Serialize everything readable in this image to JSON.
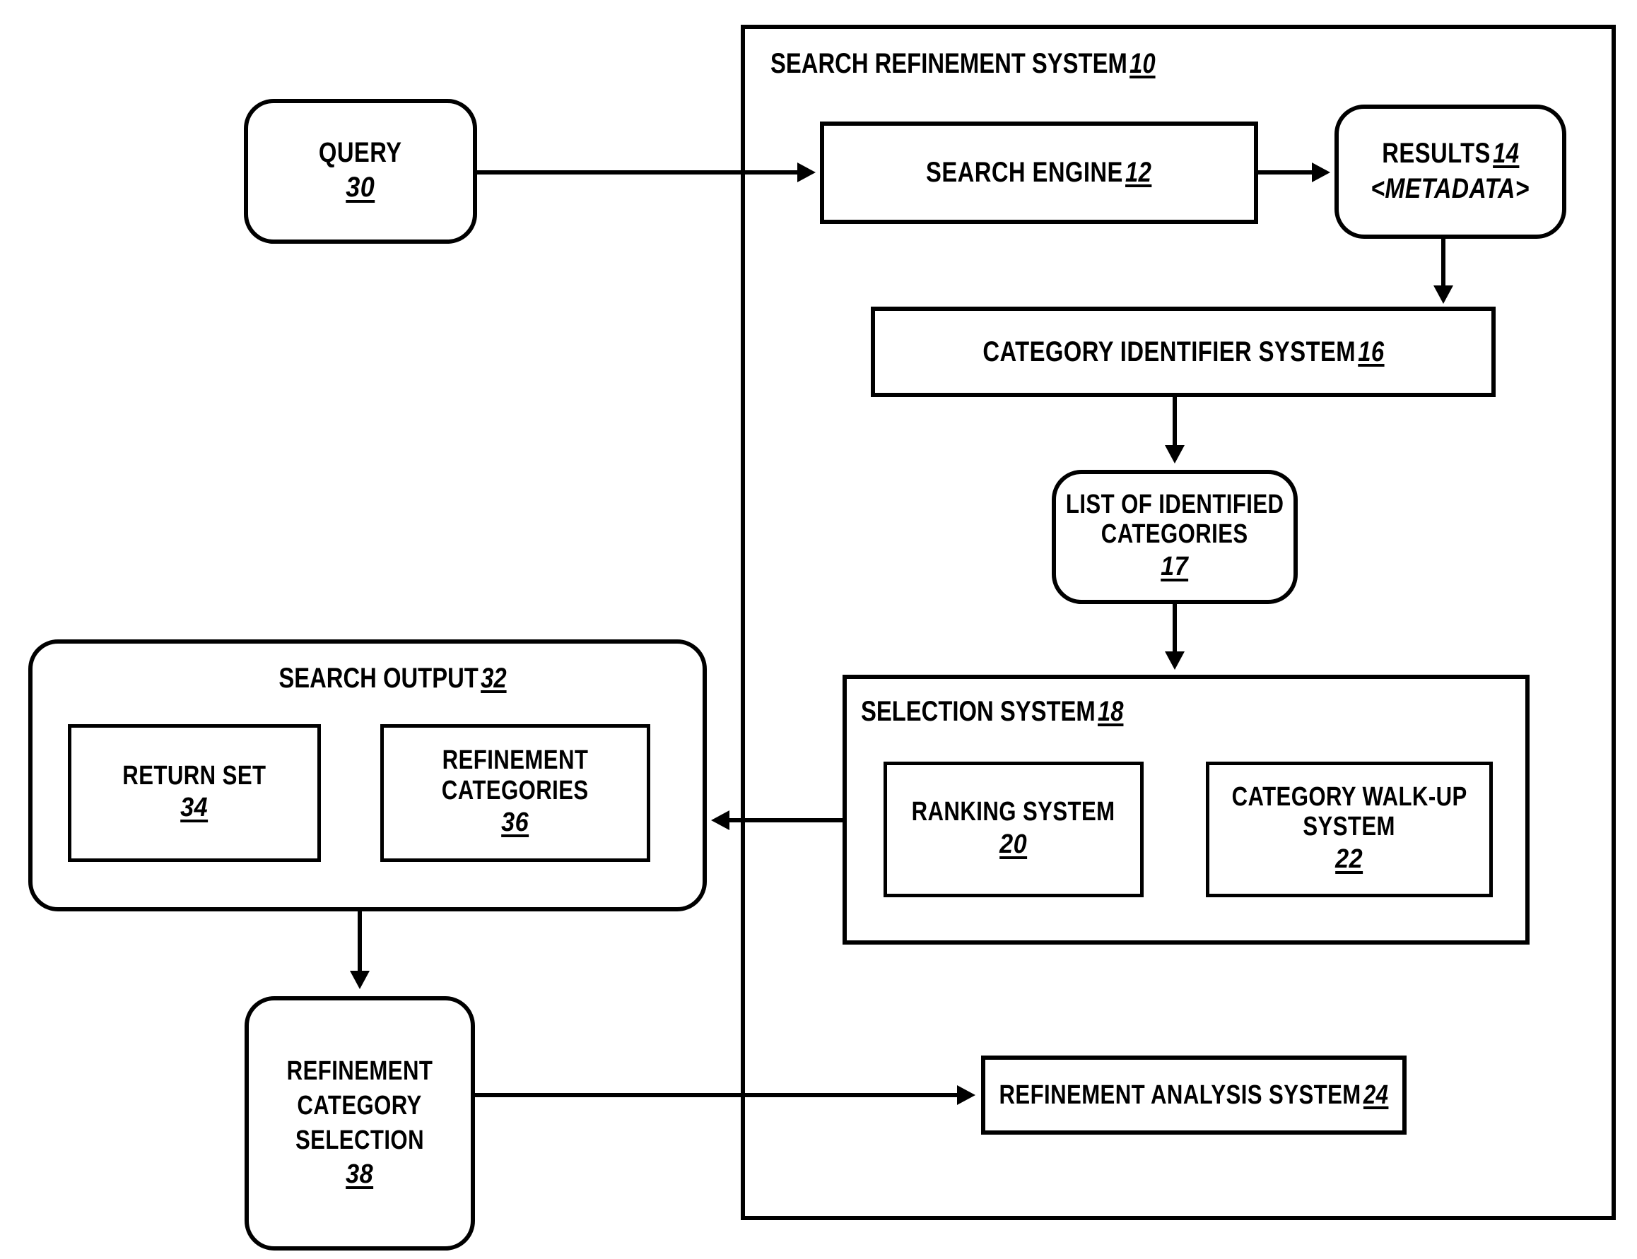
{
  "figure": {
    "type": "patent-block-diagram",
    "background": "#ffffff",
    "ink_color": "#000000"
  },
  "outer_system": {
    "label": "SEARCH REFINEMENT SYSTEM",
    "ref": "10"
  },
  "nodes": {
    "query": {
      "label": "QUERY",
      "ref": "30"
    },
    "search_engine": {
      "label": "SEARCH ENGINE",
      "ref": "12"
    },
    "results": {
      "label": "RESULTS",
      "ref": "14",
      "metadata": "<METADATA>"
    },
    "category_identifier": {
      "label": "CATEGORY IDENTIFIER SYSTEM",
      "ref": "16"
    },
    "list_categories": {
      "line1": "LIST OF IDENTIFIED",
      "line2": "CATEGORIES",
      "ref": "17"
    },
    "selection_system": {
      "label": "SELECTION SYSTEM",
      "ref": "18"
    },
    "ranking_system": {
      "label": "RANKING SYSTEM",
      "ref": "20"
    },
    "category_walkup": {
      "line1": "CATEGORY WALK-UP",
      "line2": "SYSTEM",
      "ref": "22"
    },
    "search_output": {
      "label": "SEARCH OUTPUT",
      "ref": "32"
    },
    "return_set": {
      "label": "RETURN SET",
      "ref": "34"
    },
    "refinement_categories": {
      "line1": "REFINEMENT",
      "line2": "CATEGORIES",
      "ref": "36"
    },
    "refinement_selection": {
      "line1": "REFINEMENT",
      "line2": "CATEGORY",
      "line3": "SELECTION",
      "ref": "38"
    },
    "refinement_analysis": {
      "label": "REFINEMENT ANALYSIS SYSTEM",
      "ref": "24"
    }
  },
  "connections": [
    {
      "from": "query",
      "to": "search_engine",
      "direction": "right"
    },
    {
      "from": "search_engine",
      "to": "results",
      "direction": "right"
    },
    {
      "from": "results",
      "to": "category_identifier",
      "direction": "down"
    },
    {
      "from": "category_identifier",
      "to": "list_categories",
      "direction": "down"
    },
    {
      "from": "list_categories",
      "to": "selection_system",
      "direction": "down"
    },
    {
      "from": "selection_system",
      "to": "search_output",
      "direction": "left"
    },
    {
      "from": "search_output",
      "to": "refinement_selection",
      "direction": "down"
    },
    {
      "from": "refinement_selection",
      "to": "refinement_analysis",
      "direction": "right"
    }
  ]
}
